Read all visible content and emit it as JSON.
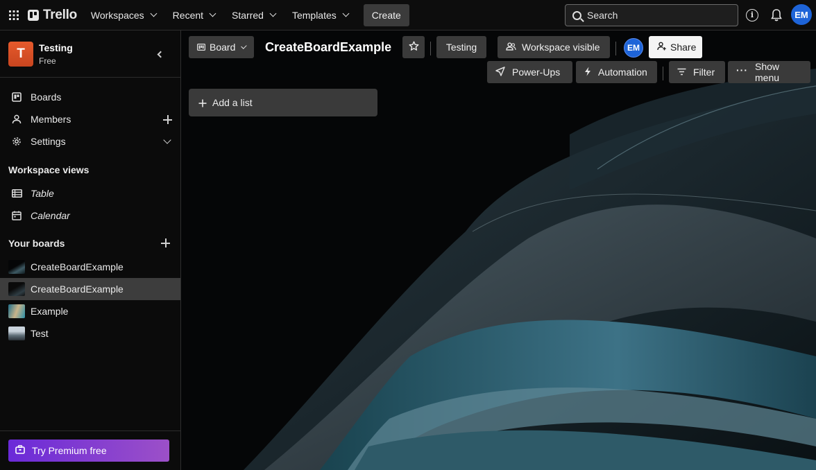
{
  "topnav": {
    "logo": "Trello",
    "menus": [
      "Workspaces",
      "Recent",
      "Starred",
      "Templates"
    ],
    "create": "Create",
    "search_placeholder": "Search",
    "user_initials": "EM"
  },
  "sidebar": {
    "workspace_initial": "T",
    "workspace_name": "Testing",
    "workspace_plan": "Free",
    "nav": {
      "boards": "Boards",
      "members": "Members",
      "settings": "Settings"
    },
    "views_heading": "Workspace views",
    "views": {
      "table": "Table",
      "calendar": "Calendar"
    },
    "your_boards_heading": "Your boards",
    "boards": [
      "CreateBoardExample",
      "CreateBoardExample",
      "Example",
      "Test"
    ],
    "premium": "Try Premium free"
  },
  "board": {
    "view_switch": "Board",
    "title": "CreateBoardExample",
    "workspace_name": "Testing",
    "visibility": "Workspace visible",
    "member_initials": "EM",
    "share": "Share",
    "power_ups": "Power-Ups",
    "automation": "Automation",
    "filter": "Filter",
    "show_menu": "Show menu",
    "add_list": "Add a list"
  },
  "colors": {
    "workspace_tile": "#e65a2c",
    "avatar": "#1e64d8",
    "premium_start": "#6a2ad8",
    "premium_end": "#9c50c8"
  }
}
